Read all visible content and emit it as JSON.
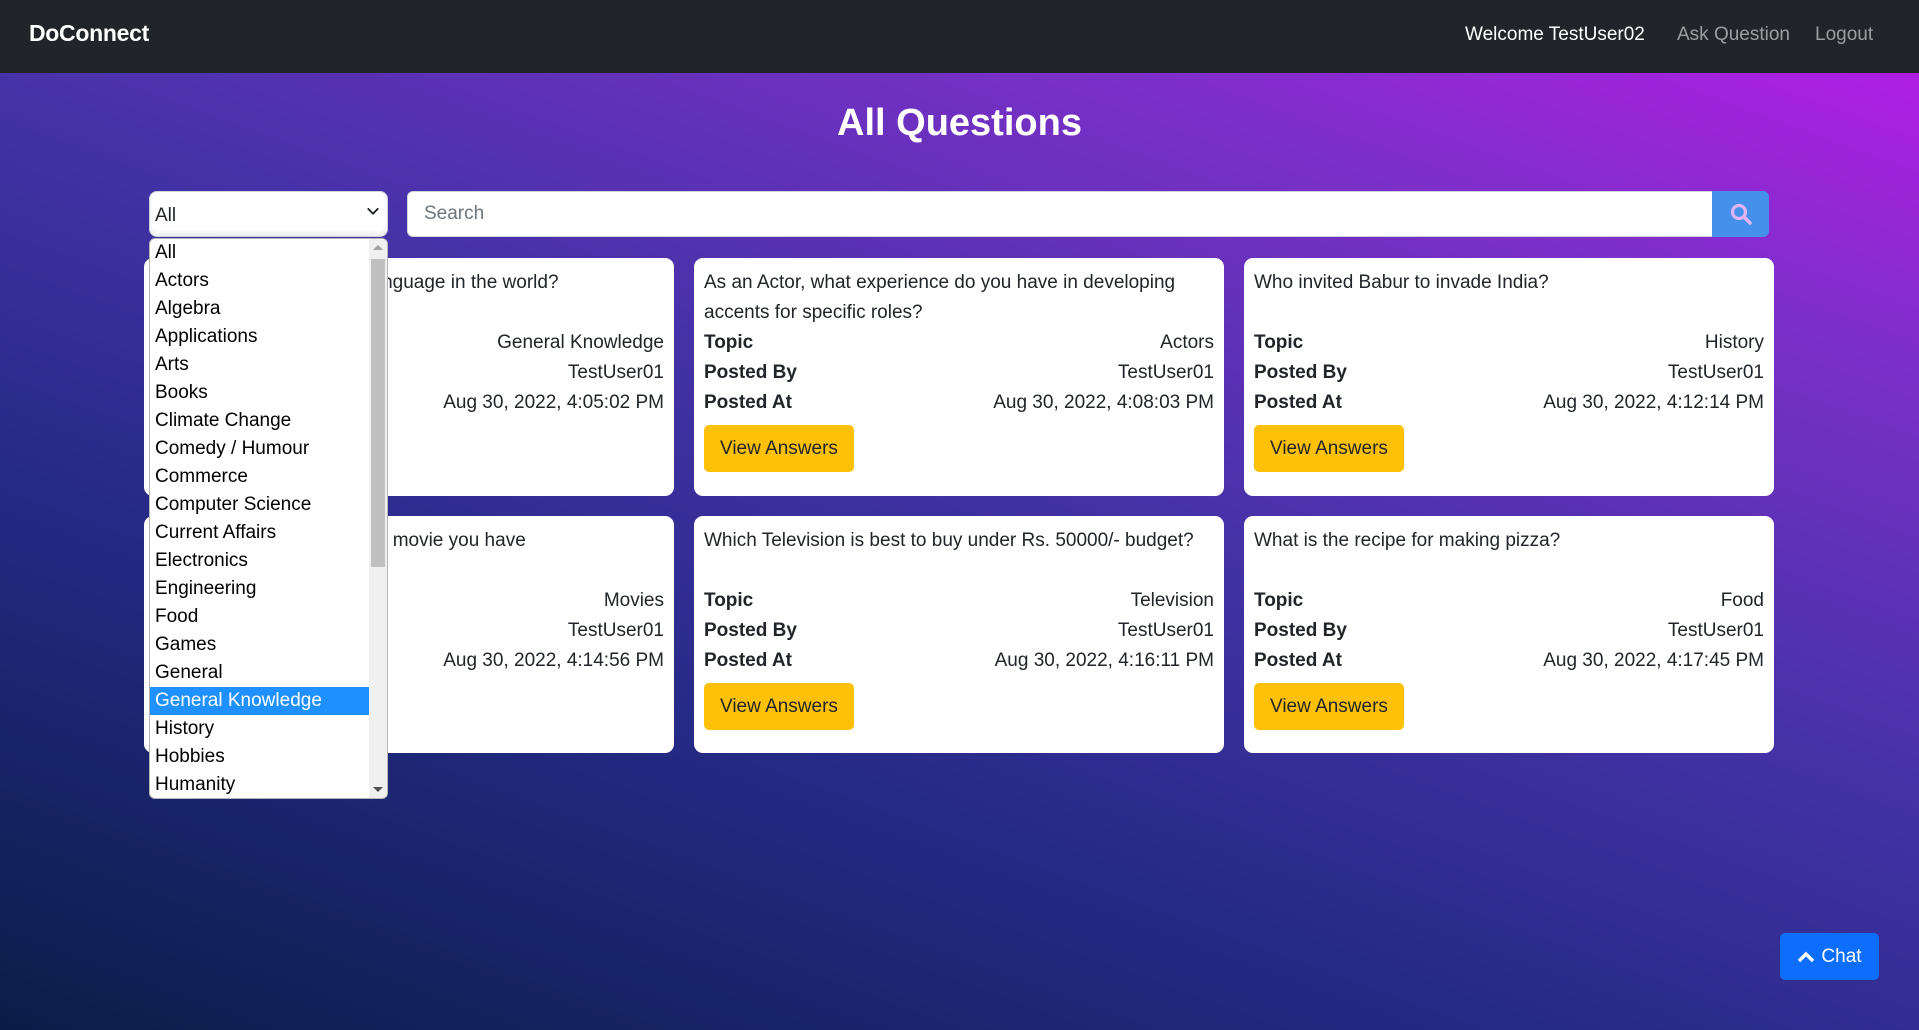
{
  "navbar": {
    "brand": "DoConnect",
    "welcome": "Welcome TestUser02",
    "ask_question": "Ask Question",
    "logout": "Logout"
  },
  "page_title": "All Questions",
  "filter": {
    "selected": "All",
    "options": [
      "All",
      "Actors",
      "Algebra",
      "Applications",
      "Arts",
      "Books",
      "Climate Change",
      "Comedy / Humour",
      "Commerce",
      "Computer Science",
      "Current Affairs",
      "Electronics",
      "Engineering",
      "Food",
      "Games",
      "General",
      "General Knowledge",
      "History",
      "Hobbies",
      "Humanity"
    ],
    "highlighted": "General Knowledge"
  },
  "search": {
    "placeholder": "Search",
    "value": "",
    "icon": "search-icon"
  },
  "labels": {
    "topic": "Topic",
    "posted_by": "Posted By",
    "posted_at": "Posted At",
    "view_answers": "View Answers"
  },
  "questions": [
    {
      "question": "What is the most spoken language in the world?",
      "visible_question": "n the world?",
      "topic": "General Knowledge",
      "posted_by": "TestUser01",
      "posted_at": "Aug 30, 2022, 4:05:02 PM"
    },
    {
      "question": "As an Actor, what experience do you have in developing accents for specific roles?",
      "topic": "Actors",
      "posted_by": "TestUser01",
      "posted_at": "Aug 30, 2022, 4:08:03 PM"
    },
    {
      "question": "Who invited Babur to invade India?",
      "topic": "History",
      "posted_by": "TestUser01",
      "posted_at": "Aug 30, 2022, 4:12:14 PM"
    },
    {
      "question": "According to you is the best movie you have",
      "visible_question": "you is the best movie you have",
      "topic": "Movies",
      "posted_by": "TestUser01",
      "posted_at": "Aug 30, 2022, 4:14:56 PM"
    },
    {
      "question": "Which Television is best to buy under Rs. 50000/- budget?",
      "topic": "Television",
      "posted_by": "TestUser01",
      "posted_at": "Aug 30, 2022, 4:16:11 PM"
    },
    {
      "question": "What is the recipe for making pizza?",
      "topic": "Food",
      "posted_by": "TestUser01",
      "posted_at": "Aug 30, 2022, 4:17:45 PM"
    }
  ],
  "chat": {
    "label": "Chat",
    "icon": "chevron-up-icon"
  },
  "colors": {
    "navbar": "#212529",
    "view_answers_button": "#ffc107",
    "chat_button": "#0d6efd",
    "search_button": "#4590ea",
    "dropdown_highlight": "#1e90ff"
  }
}
